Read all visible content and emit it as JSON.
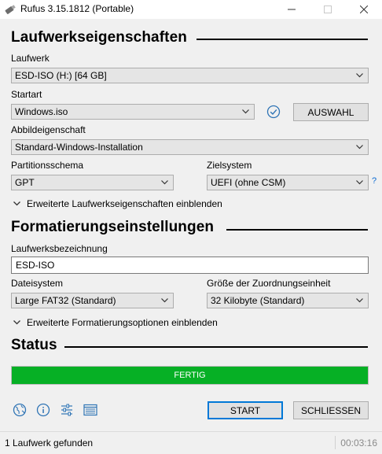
{
  "window": {
    "title": "Rufus 3.15.1812 (Portable)",
    "icon": "usb-drive-icon"
  },
  "drive_properties": {
    "heading": "Laufwerkseigenschaften",
    "device_label": "Laufwerk",
    "device_value": "ESD-ISO (H:) [64 GB]",
    "boot_label": "Startart",
    "boot_value": "Windows.iso",
    "select_button": "AUSWAHL",
    "image_option_label": "Abbildeigenschaft",
    "image_option_value": "Standard-Windows-Installation",
    "partition_label": "Partitionsschema",
    "partition_value": "GPT",
    "target_label": "Zielsystem",
    "target_value": "UEFI (ohne CSM)",
    "help_mark": "?",
    "advanced_toggle": "Erweiterte Laufwerkseigenschaften einblenden"
  },
  "format_options": {
    "heading": "Formatierungseinstellungen",
    "volume_label": "Laufwerksbezeichnung",
    "volume_value": "ESD-ISO",
    "filesystem_label": "Dateisystem",
    "filesystem_value": "Large FAT32 (Standard)",
    "cluster_label": "Größe der Zuordnungseinheit",
    "cluster_value": "32 Kilobyte (Standard)",
    "advanced_toggle": "Erweiterte Formatierungsoptionen einblenden"
  },
  "status": {
    "heading": "Status",
    "progress_text": "FERTIG",
    "progress_percent": 100,
    "progress_color": "#06b025"
  },
  "actions": {
    "start": "START",
    "close": "SCHLIESSEN",
    "icons": [
      "globe-icon",
      "info-icon",
      "settings-sliders-icon",
      "log-icon"
    ]
  },
  "statusbar": {
    "message": "1 Laufwerk gefunden",
    "elapsed": "00:03:16"
  },
  "colors": {
    "accent": "#0078d7",
    "icon_blue": "#2f74b5"
  }
}
